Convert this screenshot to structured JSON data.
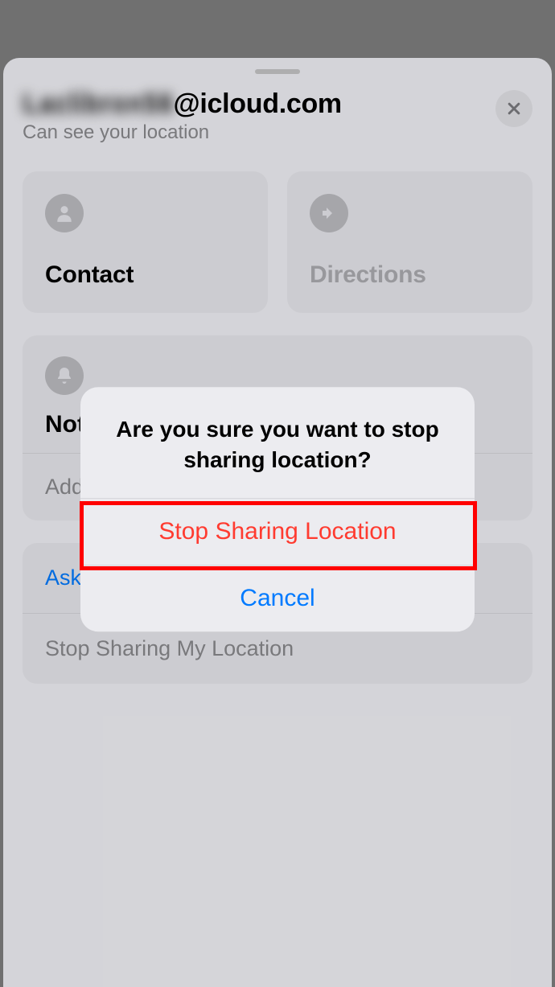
{
  "header": {
    "email_blurred": "Laclibron56",
    "email_domain": "@icloud.com",
    "subtitle": "Can see your location"
  },
  "tiles": {
    "contact": "Contact",
    "directions": "Directions"
  },
  "notifications": {
    "title": "Notifications",
    "add": "Add"
  },
  "actions": {
    "ask": "Ask To Follow Location",
    "stop": "Stop Sharing My Location"
  },
  "alert": {
    "title": "Are you sure you want to stop sharing location?",
    "destructive": "Stop Sharing Location",
    "cancel": "Cancel"
  }
}
